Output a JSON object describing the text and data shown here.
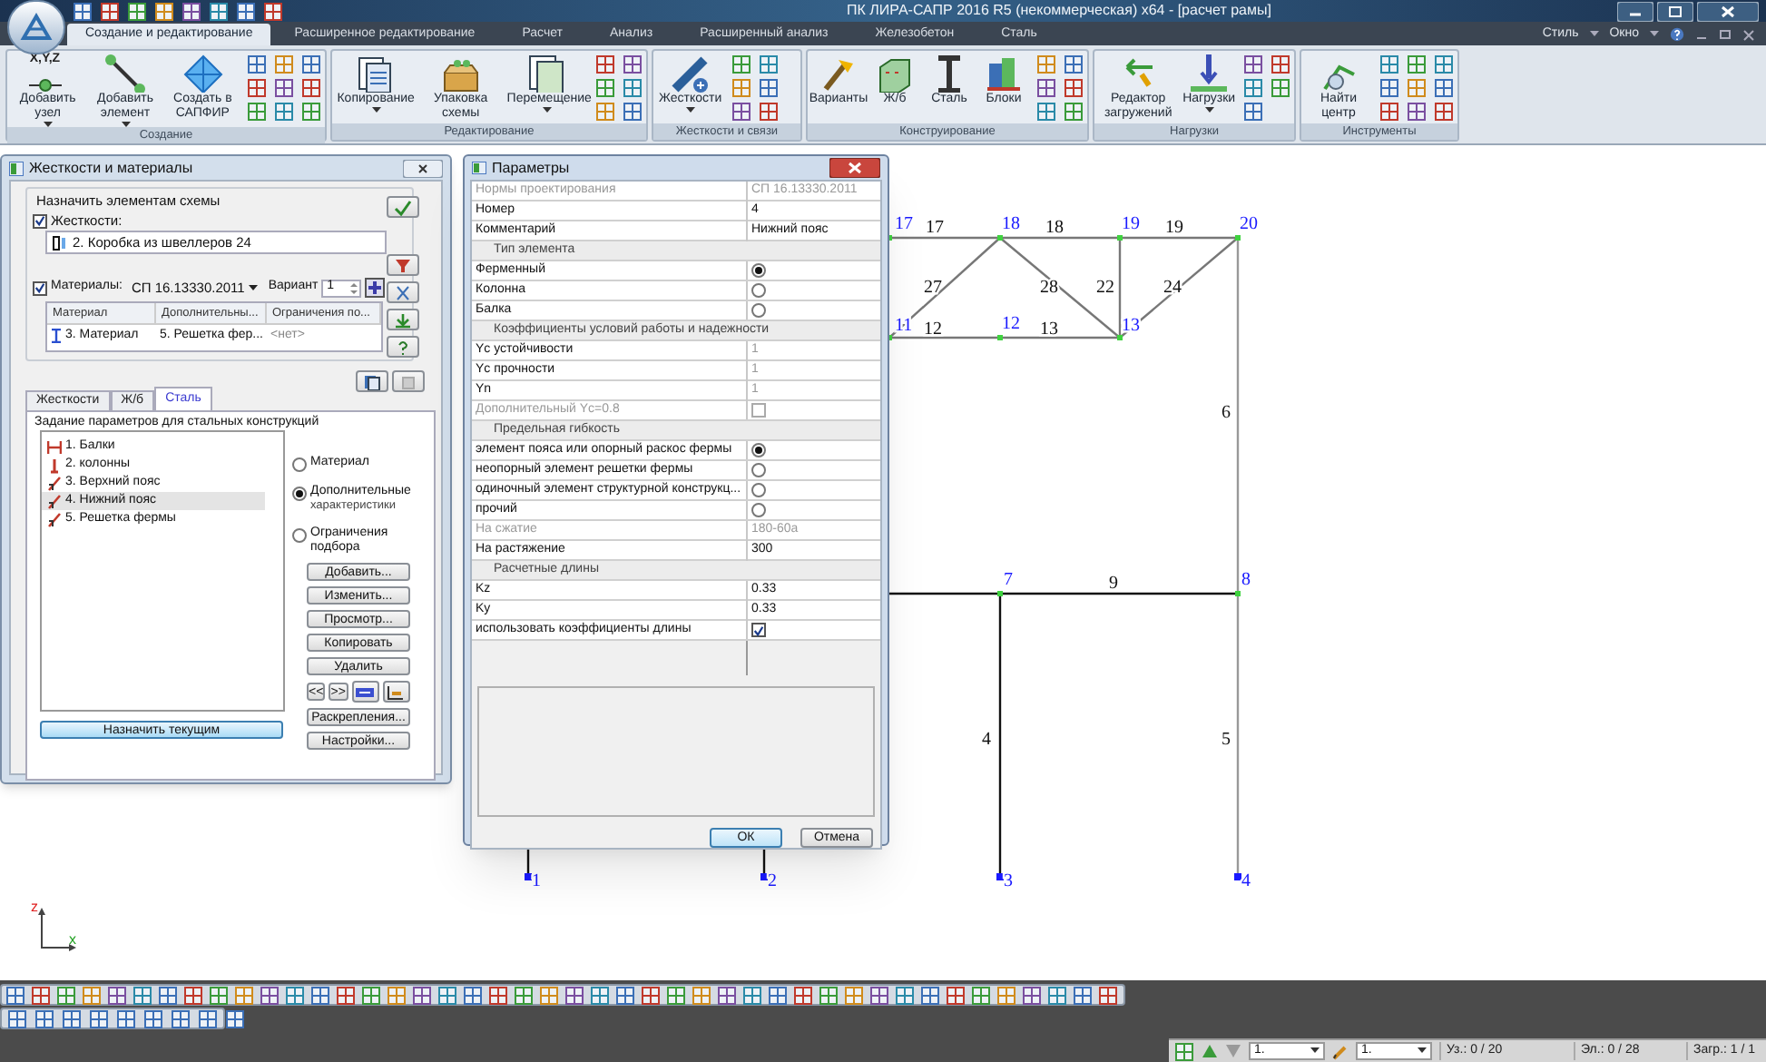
{
  "app": {
    "title": "ПК ЛИРА-САПР  2016 R5 (некоммерческая) x64 - [расчет рамы]"
  },
  "ribbon": {
    "tabs": [
      {
        "label": "Создание и редактирование",
        "selected": true
      },
      {
        "label": "Расширенное редактирование",
        "selected": false
      },
      {
        "label": "Расчет",
        "selected": false
      },
      {
        "label": "Анализ",
        "selected": false
      },
      {
        "label": "Расширенный анализ",
        "selected": false
      },
      {
        "label": "Железобетон",
        "selected": false
      },
      {
        "label": "Сталь",
        "selected": false
      }
    ],
    "menu": [
      {
        "label": "Стиль"
      },
      {
        "label": "Окно"
      }
    ],
    "groups": [
      {
        "label": "Создание",
        "buttons": [
          {
            "label": "Добавить узел",
            "dropdown": true,
            "icon_text": "X,Y,Z"
          },
          {
            "label": "Добавить элемент",
            "dropdown": true
          },
          {
            "label": "Создать в САПФИР",
            "dropdown": false
          }
        ]
      },
      {
        "label": "Редактирование",
        "buttons": [
          {
            "label": "Копирование",
            "dropdown": true
          },
          {
            "label": "Упаковка схемы",
            "dropdown": false
          },
          {
            "label": "Перемещение",
            "dropdown": true
          }
        ]
      },
      {
        "label": "Жесткости и связи",
        "buttons": [
          {
            "label": "Жесткости",
            "dropdown": true
          }
        ]
      },
      {
        "label": "Конструирование",
        "buttons": [
          {
            "label": "Варианты",
            "dropdown": false
          },
          {
            "label": "Ж/б",
            "dropdown": false
          },
          {
            "label": "Сталь",
            "dropdown": false
          },
          {
            "label": "Блоки",
            "dropdown": false
          }
        ]
      },
      {
        "label": "Нагрузки",
        "buttons": [
          {
            "label": "Редактор загружений",
            "dropdown": false
          },
          {
            "label": "Нагрузки",
            "dropdown": true
          }
        ]
      },
      {
        "label": "Инструменты",
        "buttons": [
          {
            "label": "Найти центр",
            "dropdown": false
          }
        ]
      }
    ]
  },
  "stiffness_panel": {
    "title": "Жесткости и материалы",
    "assign_label": "Назначить элементам схемы",
    "stiffness": {
      "checked": true,
      "label": "Жесткости:",
      "value": "2. Коробка из швеллеров 24"
    },
    "materials": {
      "checked": true,
      "label": "Материалы:",
      "norm": "СП 16.13330.2011",
      "variant_label": "Вариант",
      "variant": "1"
    },
    "table": {
      "columns": [
        "Материал",
        "Дополнительны...",
        "Ограничения по..."
      ],
      "rows": [
        [
          "3. Материал",
          "5. Решетка фер...",
          "<нет>"
        ]
      ]
    },
    "tabs": [
      {
        "label": "Жесткости",
        "selected": false
      },
      {
        "label": "Ж/б",
        "selected": false
      },
      {
        "label": "Сталь",
        "selected": true
      }
    ],
    "section_label": "Задание параметров для стальных конструкций",
    "items": [
      {
        "label": "1. Балки",
        "kind": "beam",
        "selected": false
      },
      {
        "label": "2. колонны",
        "kind": "column",
        "selected": false
      },
      {
        "label": "3. Верхний пояс",
        "kind": "truss",
        "selected": false
      },
      {
        "label": "4. Нижний пояс",
        "kind": "truss",
        "selected": true
      },
      {
        "label": "5. Решетка фермы",
        "kind": "truss",
        "selected": false
      }
    ],
    "modes": [
      {
        "label": "Материал",
        "selected": false
      },
      {
        "label": "Дополнительные",
        "sublabel": "характеристики",
        "selected": true
      },
      {
        "label": "Ограничения подбора",
        "selected": false
      }
    ],
    "buttons": [
      "Добавить...",
      "Изменить...",
      "Просмотр...",
      "Копировать",
      "Удалить"
    ],
    "nav": [
      "<<",
      ">>"
    ],
    "buttons_2": [
      "Раскрепления...",
      "Настройки..."
    ],
    "assign_button": "Назначить текущим"
  },
  "params_dialog": {
    "title": "Параметры",
    "rows": [
      {
        "kind": "field",
        "label": "Нормы проектирования",
        "value": "СП 16.13330.2011",
        "disabled": true,
        "readonly": true
      },
      {
        "kind": "field",
        "label": "Номер",
        "value": "4",
        "disabled": false,
        "readonly": false
      },
      {
        "kind": "field",
        "label": "Комментарий",
        "value": "Нижний пояс",
        "disabled": false,
        "readonly": false
      },
      {
        "kind": "header",
        "label": "Тип элемента"
      },
      {
        "kind": "radio",
        "label": "Ферменный",
        "selected": true
      },
      {
        "kind": "radio",
        "label": "Колонна",
        "selected": false
      },
      {
        "kind": "radio",
        "label": "Балка",
        "selected": false
      },
      {
        "kind": "header",
        "label": "Коэффициенты условий работы и надежности"
      },
      {
        "kind": "field",
        "label": "Yc устойчивости",
        "value": "1",
        "disabled": false,
        "readonly": true
      },
      {
        "kind": "field",
        "label": "Yc прочности",
        "value": "1",
        "disabled": false,
        "readonly": true
      },
      {
        "kind": "field",
        "label": "Yn",
        "value": "1",
        "disabled": false,
        "readonly": true
      },
      {
        "kind": "check",
        "label": "Дополнительный Yc=0.8",
        "checked": false,
        "disabled": true
      },
      {
        "kind": "header",
        "label": "Предельная гибкость"
      },
      {
        "kind": "radio",
        "label": "элемент пояса или опорный раскос фермы",
        "selected": true
      },
      {
        "kind": "radio",
        "label": "неопорный элемент решетки фермы",
        "selected": false
      },
      {
        "kind": "radio",
        "label": "одиночный элемент структурной конструкц...",
        "selected": false
      },
      {
        "kind": "radio",
        "label": "прочий",
        "selected": false
      },
      {
        "kind": "field",
        "label": "На сжатие",
        "value": "180-60a",
        "disabled": true,
        "readonly": true
      },
      {
        "kind": "field",
        "label": "На растяжение",
        "value": "300",
        "disabled": false,
        "readonly": false
      },
      {
        "kind": "header",
        "label": "Расчетные длины"
      },
      {
        "kind": "field",
        "label": "Kz",
        "value": "0.33",
        "disabled": false,
        "readonly": false
      },
      {
        "kind": "field",
        "label": "Ky",
        "value": "0.33",
        "disabled": false,
        "readonly": false
      },
      {
        "kind": "check",
        "label": "использовать коэффициенты длины",
        "checked": true,
        "disabled": false
      }
    ],
    "ok": "ОК",
    "cancel": "Отмена"
  },
  "canvas": {
    "nodes": [
      {
        "label": "17"
      },
      {
        "label": "18"
      },
      {
        "label": "19"
      },
      {
        "label": "20"
      },
      {
        "label": "11"
      },
      {
        "label": "12"
      },
      {
        "label": "13"
      },
      {
        "label": "7"
      },
      {
        "label": "8"
      },
      {
        "label": "1"
      },
      {
        "label": "2"
      },
      {
        "label": "3"
      },
      {
        "label": "4"
      }
    ],
    "elements": [
      {
        "label": "17"
      },
      {
        "label": "18"
      },
      {
        "label": "19"
      },
      {
        "label": "27"
      },
      {
        "label": "28"
      },
      {
        "label": "22"
      },
      {
        "label": "24"
      },
      {
        "label": "12"
      },
      {
        "label": "13"
      },
      {
        "label": "6"
      },
      {
        "label": "9"
      },
      {
        "label": "4"
      },
      {
        "label": "5"
      }
    ],
    "axes": {
      "z": "z",
      "x": "x"
    }
  },
  "status_bar": {
    "dropdowns": [
      "1.",
      "1."
    ],
    "nodes": "Уз.: 0 / 20",
    "elements": "Эл.: 0 / 28",
    "loads": "Загр.: 1 / 1"
  }
}
